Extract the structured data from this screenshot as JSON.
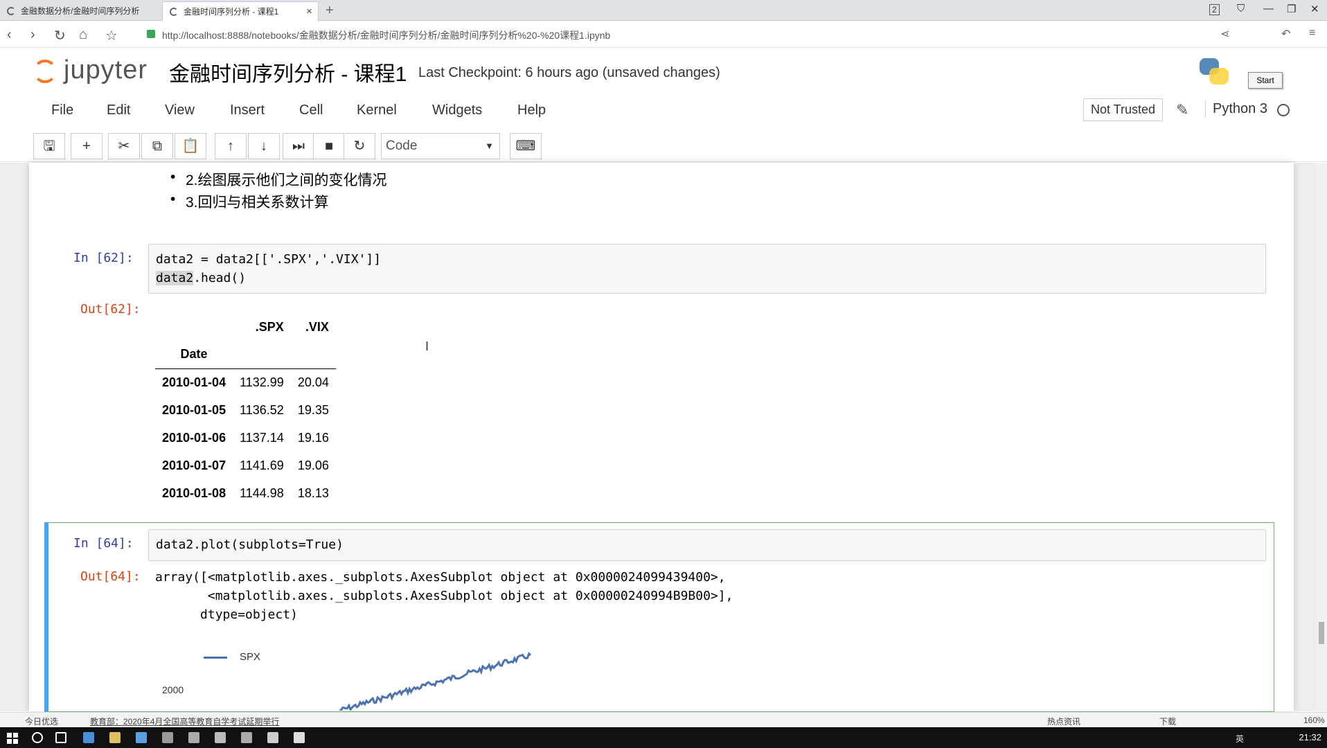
{
  "browser": {
    "tabs": [
      {
        "label": "金融数据分析/金融时间序列分析",
        "active": false
      },
      {
        "label": "金融时间序列分析 - 课程1",
        "active": true
      }
    ],
    "url": "http://localhost:8888/notebooks/金融数据分析/金融时间序列分析/金融时间序列分析%20-%20课程1.ipynb",
    "tab_count_badge": "2"
  },
  "jupyter": {
    "logo_text": "jupyter",
    "notebook_title": "金融时间序列分析 - 课程1",
    "checkpoint": "Last Checkpoint: 6 hours ago (unsaved changes)",
    "start_button": "Start",
    "menu": [
      "File",
      "Edit",
      "View",
      "Insert",
      "Cell",
      "Kernel",
      "Widgets",
      "Help"
    ],
    "trust_status": "Not Trusted",
    "kernel_name": "Python 3",
    "cell_type": "Code",
    "toolbar_icons": [
      "save-icon",
      "plus-icon",
      "cut-icon",
      "copy-icon",
      "paste-icon",
      "arrow-up-icon",
      "arrow-down-icon",
      "run-icon",
      "stop-icon",
      "restart-icon",
      "keyboard-icon"
    ]
  },
  "cells": {
    "markdown_items": [
      "2.绘图展示他们之间的变化情况",
      "3.回归与相关系数计算"
    ],
    "cell62": {
      "in_prompt": "In  [62]:",
      "code_line1": "data2 = data2[['.SPX','.VIX']]",
      "code_line2_var": "data2",
      "code_line2_rest": ".head()",
      "out_prompt": "Out[62]:",
      "table": {
        "columns": [
          ".SPX",
          ".VIX"
        ],
        "index_name": "Date",
        "rows": [
          {
            "date": "2010-01-04",
            "spx": "1132.99",
            "vix": "20.04"
          },
          {
            "date": "2010-01-05",
            "spx": "1136.52",
            "vix": "19.35"
          },
          {
            "date": "2010-01-06",
            "spx": "1137.14",
            "vix": "19.16"
          },
          {
            "date": "2010-01-07",
            "spx": "1141.69",
            "vix": "19.06"
          },
          {
            "date": "2010-01-08",
            "spx": "1144.98",
            "vix": "18.13"
          }
        ]
      }
    },
    "cell64": {
      "in_prompt": "In  [64]:",
      "code": "data2.plot(subplots=True)",
      "out_prompt": "Out[64]:",
      "output_line1": "array([<matplotlib.axes._subplots.AxesSubplot object at 0x0000024099439400>,",
      "output_line2": "       <matplotlib.axes._subplots.AxesSubplot object at 0x00000240994B9B00>],",
      "output_line3": "      dtype=object)",
      "plot_legend": "SPX",
      "plot_ytick": "2000"
    }
  },
  "chart_data": {
    "type": "line",
    "title": "",
    "series": [
      {
        "name": "SPX",
        "color": "#4c72b0"
      }
    ],
    "visible_ytick": "2000"
  },
  "os": {
    "status_left": "今日优选",
    "status_news": "教育部：2020年4月全国高等教育自学考试延期举行",
    "status_right": [
      "热点资讯",
      "下载"
    ],
    "zoom": "160%",
    "time": "21:32",
    "ime": "英"
  }
}
